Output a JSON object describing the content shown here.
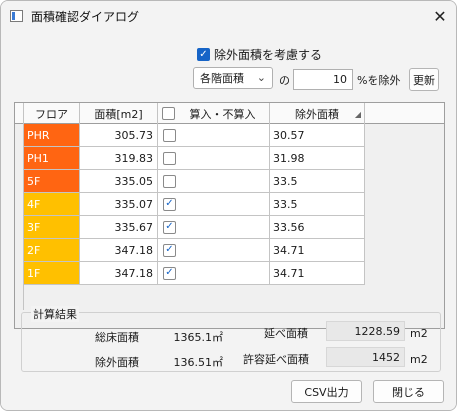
{
  "window": {
    "title": "面積確認ダイアログ",
    "close_symbol": "✕"
  },
  "options": {
    "exclude_label": "除外面積を考慮する",
    "exclude_checked": true,
    "select_value": "各階面積",
    "no_label": "の",
    "percent_value": "10",
    "percent_suffix": "%を除外",
    "update_label": "更新"
  },
  "table": {
    "headers": {
      "floor": "フロア",
      "area": "面積[m2]",
      "include": "算入・不算入",
      "excluded": "除外面積"
    },
    "rows": [
      {
        "floor": "PHR",
        "area": "305.73",
        "included": false,
        "excluded": "30.57",
        "color": "#ff6512"
      },
      {
        "floor": "PH1",
        "area": "319.83",
        "included": false,
        "excluded": "31.98",
        "color": "#ff6512"
      },
      {
        "floor": "5F",
        "area": "335.05",
        "included": false,
        "excluded": "33.5",
        "color": "#ff6512"
      },
      {
        "floor": "4F",
        "area": "335.07",
        "included": true,
        "excluded": "33.5",
        "color": "#ffc000"
      },
      {
        "floor": "3F",
        "area": "335.67",
        "included": true,
        "excluded": "33.56",
        "color": "#ffc000"
      },
      {
        "floor": "2F",
        "area": "347.18",
        "included": true,
        "excluded": "34.71",
        "color": "#ffc000"
      },
      {
        "floor": "1F",
        "area": "347.18",
        "included": true,
        "excluded": "34.71",
        "color": "#ffc000"
      }
    ]
  },
  "results": {
    "title": "計算結果",
    "total_floor_label": "総床面積",
    "total_floor_value": "1365.1㎡",
    "excluded_label": "除外面積",
    "excluded_value": "136.51㎡",
    "gross_label": "延べ面積",
    "gross_value": "1228.59",
    "allowed_label": "許容延べ面積",
    "allowed_value": "1452",
    "unit": "m2"
  },
  "buttons": {
    "csv": "CSV出力",
    "close": "閉じる"
  },
  "colors": {
    "check_accent": "#1664c7",
    "upper_floor": "#ff6512",
    "lower_floor": "#ffc000"
  }
}
